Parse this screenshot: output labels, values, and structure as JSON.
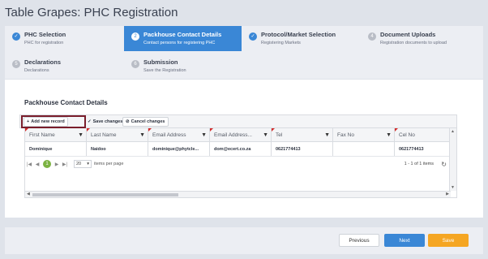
{
  "page": {
    "title": "Table Grapes: PHC Registration"
  },
  "wizard": {
    "steps": [
      {
        "num": "✓",
        "title": "PHC Selection",
        "sub": "PHC for registration"
      },
      {
        "num": "2",
        "title": "Packhouse Contact Details",
        "sub": "Contact persons for registering PHC"
      },
      {
        "num": "✓",
        "title": "Protocol/Market Selection",
        "sub": "Registering Markets"
      },
      {
        "num": "4",
        "title": "Document Uploads",
        "sub": "Registration documents to upload"
      },
      {
        "num": "5",
        "title": "Declarations",
        "sub": "Declarations"
      },
      {
        "num": "6",
        "title": "Submission",
        "sub": "Save the Registration"
      }
    ]
  },
  "panel": {
    "title": "Packhouse Contact Details"
  },
  "toolbar": {
    "add_label": "Add new record",
    "save_label": "Save changes",
    "cancel_label": "Cancel changes"
  },
  "grid": {
    "columns": [
      "First Name",
      "Last Name",
      "Email Address",
      "Email Address...",
      "Tel",
      "Fax No",
      "Cel No"
    ],
    "rows": [
      [
        "Dominique",
        "Naidoo",
        "dominique@phytcle...",
        "dom@ecert.co.za",
        "0621774413",
        "",
        "0621774413"
      ]
    ],
    "pager": {
      "first": "|◀",
      "prev": "◀",
      "current_page": "1",
      "next": "▶",
      "last": "▶|",
      "page_size": "20",
      "items_per_page_label": "items per page",
      "count_label": "1 - 1 of 1 items"
    }
  },
  "footer": {
    "previous_label": "Previous",
    "next_label": "Next",
    "save_label": "Save"
  },
  "colors": {
    "accent": "#3a87d6",
    "save": "#f5a623",
    "highlight_border": "#7a1e2c",
    "pager_active": "#7cb342"
  }
}
